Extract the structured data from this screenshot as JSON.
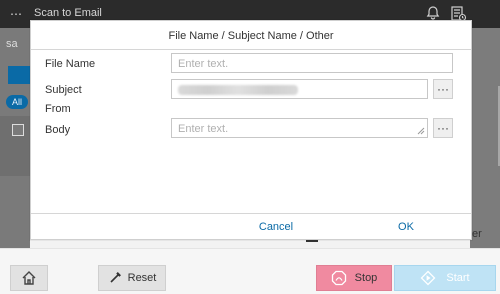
{
  "topbar": {
    "title": "Scan to Email",
    "menu_icon": "ellipsis-icon",
    "icons": [
      "bell-icon",
      "job-status-icon"
    ]
  },
  "background": {
    "search_stub": "sa",
    "filter_chip": "All",
    "right_text": "er"
  },
  "modal": {
    "title": "File Name / Subject Name / Other",
    "fields": {
      "file_name": {
        "label": "File Name",
        "placeholder": "Enter text."
      },
      "subject": {
        "label": "Subject",
        "value": ""
      },
      "from": {
        "label": "From"
      },
      "body": {
        "label": "Body",
        "placeholder": "Enter text."
      }
    },
    "more_button_label": "···",
    "cancel": "Cancel",
    "ok": "OK"
  },
  "bottombar": {
    "reset": "Reset",
    "stop": "Stop",
    "start": "Start"
  },
  "colors": {
    "accent_blue": "#0a6aa6",
    "stop_pink": "#f08aa0",
    "start_light_blue": "#bfe3f5",
    "topbar_dark": "#2b2b2b"
  }
}
